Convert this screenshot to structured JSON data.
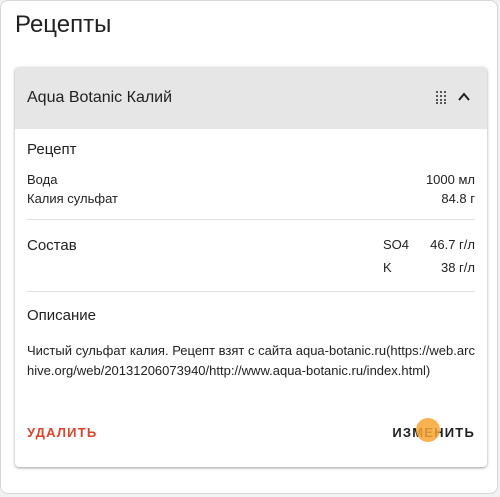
{
  "page": {
    "title": "Рецепты"
  },
  "recipe": {
    "name": "Aqua Botanic Калий",
    "recipe_section": {
      "title": "Рецепт",
      "items": [
        {
          "label": "Вода",
          "value": "1000 мл"
        },
        {
          "label": "Калия сульфат",
          "value": "84.8 г"
        }
      ]
    },
    "composition_section": {
      "title": "Состав",
      "items": [
        {
          "element": "SO4",
          "value": "46.7 г/л"
        },
        {
          "element": "K",
          "value": "38 г/л"
        }
      ]
    },
    "description_section": {
      "title": "Описание",
      "text": "Чистый сульфат калия. Рецепт взят с сайта aqua-botanic.ru(https://web.archive.org/web/20131206073940/http://www.aqua-botanic.ru/index.html)"
    },
    "actions": {
      "delete_label": "УДАЛИТЬ",
      "edit_label": "ИЗМЕНИТЬ"
    }
  },
  "icons": {
    "grid": "grid-dots-icon",
    "chevron": "chevron-up-icon"
  },
  "colors": {
    "delete": "#d9442a",
    "header_bg": "#e6e6e6",
    "cursor": "#f7a432"
  }
}
